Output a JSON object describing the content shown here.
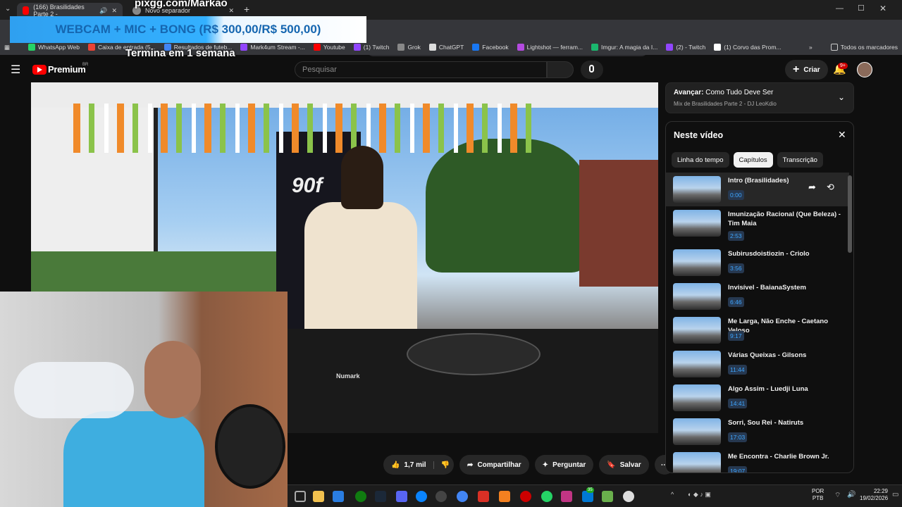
{
  "browser": {
    "tabs": [
      {
        "title": "(166) Brasilidades Parte 2 -",
        "active": true
      },
      {
        "title": "Novo separador",
        "active": false
      }
    ],
    "bookmarks": [
      "WhatsApp Web",
      "Caixa de entrada (5...",
      "Resultados de futeb...",
      "Mark4um Stream -...",
      "Youtube",
      "(1) Twitch",
      "Grok",
      "ChatGPT",
      "Facebook",
      "Lightshot — ferram...",
      "Imgur: A magia da I...",
      "(2) - Twitch",
      "(1) Corvo das Prom..."
    ],
    "all_bookmarks": "Todos os marcadores",
    "overflow": "»"
  },
  "overlay": {
    "top_text": "pixgg.com/Markao",
    "banner": "WEBCAM + MIC + BONG (R$ 300,00/R$ 500,00)",
    "subtext": "Termina em 1 semana"
  },
  "youtube": {
    "logo_text": "Premium",
    "logo_badge": "BR",
    "search_placeholder": "Pesquisar",
    "create_label": "Criar",
    "notif_count": "9+"
  },
  "player": {
    "actions": {
      "likes": "1,7 mil",
      "share": "Compartilhar",
      "ask": "Perguntar",
      "save": "Salvar"
    },
    "banner_text": "90f",
    "brand_text": "Numark"
  },
  "next_up": {
    "prefix": "Avançar:",
    "title": "Como Tudo Deve Ser",
    "playlist": "Mix de Brasilidades Parte 2 - DJ LeoKdio"
  },
  "panel": {
    "title": "Neste vídeo",
    "tabs": [
      "Linha do tempo",
      "Capítulos",
      "Transcrição"
    ],
    "selected_tab": "Capítulos",
    "chapters": [
      {
        "title": "Intro (Brasilidades)",
        "time": "0:00"
      },
      {
        "title": "Imunização Racional (Que Beleza) - Tim Maia",
        "time": "2:53"
      },
      {
        "title": "Subirusdoistiozin - Criolo",
        "time": "3:56"
      },
      {
        "title": "Invisível - BaianaSystem",
        "time": "6:46"
      },
      {
        "title": "Me Larga, Não Enche - Caetano Veloso",
        "time": "9:17"
      },
      {
        "title": "Várias Queixas - Gilsons",
        "time": "11:44"
      },
      {
        "title": "Algo Assim - Luedji Luna",
        "time": "14:41"
      },
      {
        "title": "Sorri, Sou Rei - Natiruts",
        "time": "17:03"
      },
      {
        "title": "Me Encontra - Charlie Brown Jr.",
        "time": "19:07"
      }
    ]
  },
  "taskbar": {
    "lang": "POR",
    "layout": "PTB",
    "time": "22:29",
    "date": "19/02/2026",
    "badge": "35"
  }
}
